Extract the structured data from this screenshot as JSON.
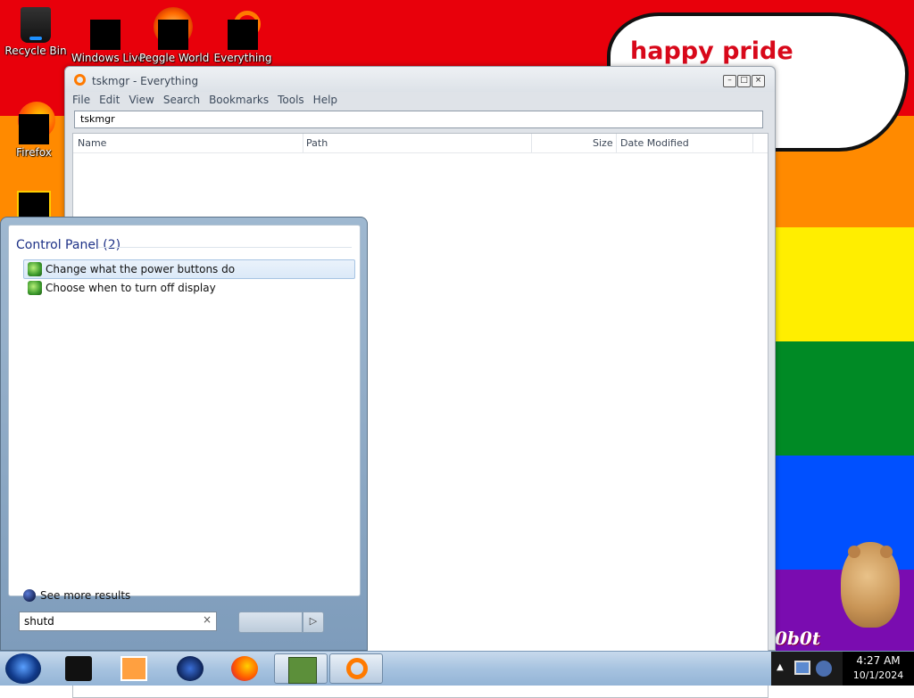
{
  "wallpaper": {
    "cloud_text": "happy pride month",
    "sticker_text": "0b0t"
  },
  "desktop_icons": [
    {
      "label": "Recycle Bin"
    },
    {
      "label": "Windows Live"
    },
    {
      "label": "Peggle World"
    },
    {
      "label": "Everything"
    },
    {
      "label": "Firefox"
    }
  ],
  "everything_window": {
    "title": "tskmgr - Everything",
    "menu": [
      "File",
      "Edit",
      "View",
      "Search",
      "Bookmarks",
      "Tools",
      "Help"
    ],
    "search_value": "tskmgr",
    "columns": [
      "Name",
      "Path",
      "Size",
      "Date Modified"
    ]
  },
  "start_menu": {
    "section_title": "Control Panel (2)",
    "results": [
      {
        "label": "Change what the power buttons do",
        "selected": true
      },
      {
        "label": "Choose when to turn off display",
        "selected": false
      }
    ],
    "see_more": "See more results",
    "search_value": "shutd",
    "clear_glyph": "×",
    "shutdown_arrow": "▷"
  },
  "taskbar": {
    "time": "4:27 AM",
    "date": "10/1/2024",
    "tray_arrow": "▲",
    "pinned": [
      "explorer",
      "media-player",
      "windows-live",
      "firefox",
      "peggle-box",
      "everything"
    ]
  },
  "colors": {
    "red": "#e8000b",
    "orange": "#ff8a00",
    "yellow": "#ffee00",
    "green": "#008a25",
    "blue": "#0050ff",
    "purple": "#7a0cb0"
  }
}
